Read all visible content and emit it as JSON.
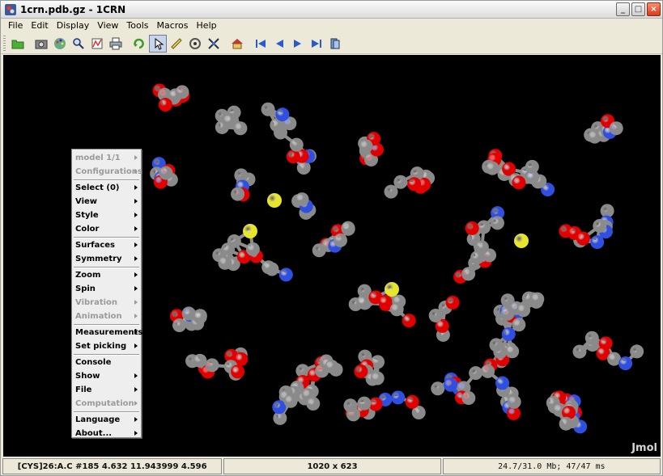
{
  "window": {
    "title": "1crn.pdb.gz - 1CRN"
  },
  "title_buttons": [
    "minimize-button",
    "maximize-button",
    "close-button"
  ],
  "menubar": {
    "items": [
      {
        "label": "File"
      },
      {
        "label": "Edit"
      },
      {
        "label": "Display"
      },
      {
        "label": "View"
      },
      {
        "label": "Tools"
      },
      {
        "label": "Macros"
      },
      {
        "label": "Help"
      }
    ]
  },
  "toolbar": {
    "icons": [
      "open-folder-icon",
      "screenshot-icon",
      "palette-icon",
      "magnifier-icon",
      "spectrum-icon",
      "print-icon",
      "rotate-icon",
      "pick-icon",
      "ruler-icon",
      "spin-icon",
      "crossed-arrows-icon",
      "home-icon",
      "first-frame-icon",
      "prev-frame-icon",
      "next-frame-icon",
      "last-frame-icon",
      "play-icon"
    ]
  },
  "viewer": {
    "watermark": "Jmol"
  },
  "popup_menu": {
    "groups": [
      [
        {
          "label": "model 1/1",
          "disabled": true,
          "submenu": true
        },
        {
          "label": "Configurations",
          "disabled": true,
          "submenu": true
        }
      ],
      [
        {
          "label": "Select (0)",
          "disabled": false,
          "submenu": true
        },
        {
          "label": "View",
          "disabled": false,
          "submenu": true
        },
        {
          "label": "Style",
          "disabled": false,
          "submenu": true
        },
        {
          "label": "Color",
          "disabled": false,
          "submenu": true
        }
      ],
      [
        {
          "label": "Surfaces",
          "disabled": false,
          "submenu": true
        },
        {
          "label": "Symmetry",
          "disabled": false,
          "submenu": true
        }
      ],
      [
        {
          "label": "Zoom",
          "disabled": false,
          "submenu": true
        },
        {
          "label": "Spin",
          "disabled": false,
          "submenu": true
        },
        {
          "label": "Vibration",
          "disabled": true,
          "submenu": true
        },
        {
          "label": "Animation",
          "disabled": true,
          "submenu": true
        }
      ],
      [
        {
          "label": "Measurements",
          "disabled": false,
          "submenu": true
        },
        {
          "label": "Set picking",
          "disabled": false,
          "submenu": true
        }
      ],
      [
        {
          "label": "Console",
          "disabled": false,
          "submenu": false
        },
        {
          "label": "Show",
          "disabled": false,
          "submenu": true
        },
        {
          "label": "File",
          "disabled": false,
          "submenu": true
        },
        {
          "label": "Computation",
          "disabled": true,
          "submenu": true
        }
      ],
      [
        {
          "label": "Language",
          "disabled": false,
          "submenu": true
        },
        {
          "label": "About...",
          "disabled": false,
          "submenu": true
        }
      ]
    ]
  },
  "status": {
    "atom_info": "[CYS]26:A.C #185 4.632 11.943999 4.596",
    "dimensions": "1020 x 623",
    "memory": "24.7/31.0 Mb;  47/47 ms"
  },
  "colors": {
    "carbon": "#8a8a8a",
    "oxygen": "#e00000",
    "nitrogen": "#2f4fe0",
    "sulfur": "#e6e62a",
    "background": "#000000"
  }
}
